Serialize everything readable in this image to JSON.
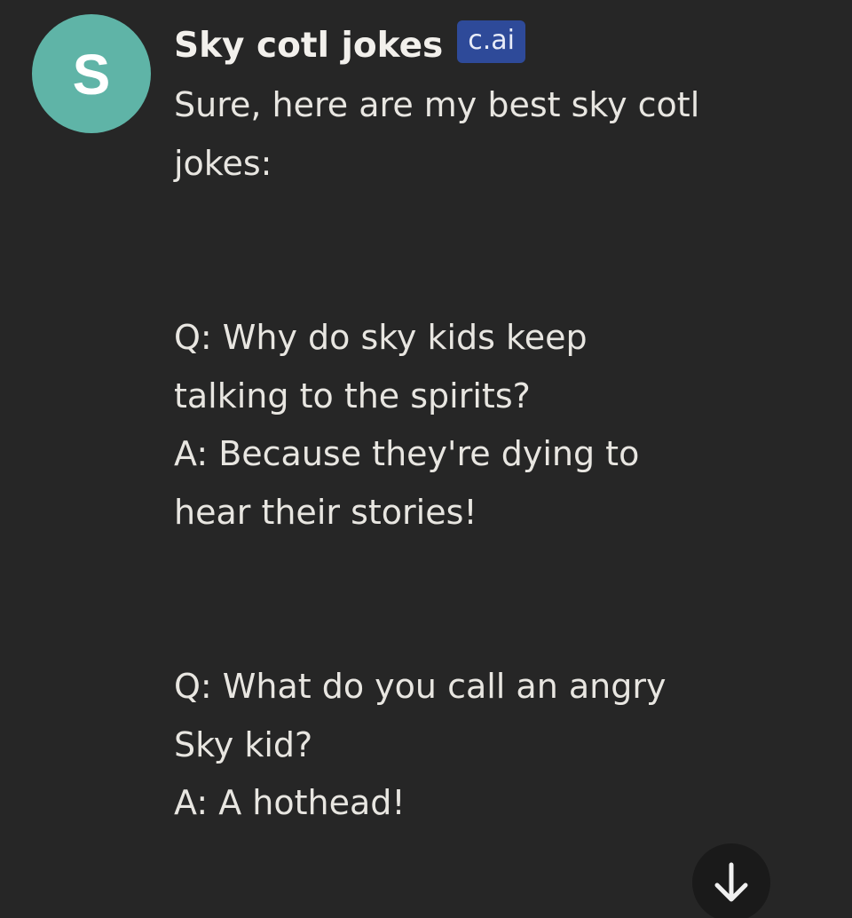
{
  "character": {
    "avatar_letter": "S",
    "name": "Sky cotl jokes",
    "badge": "c.ai"
  },
  "message": {
    "intro_line1": "Sure, here are my best sky cotl",
    "intro_line2": "jokes:",
    "joke1": {
      "q_line1": "Q: Why do sky kids keep",
      "q_line2": "talking to the spirits?",
      "a_line1": "A: Because they're dying to",
      "a_line2": "hear their stories!"
    },
    "joke2": {
      "q_line1": "Q: What do you call an angry",
      "q_line2": "Sky kid?",
      "a_line1": "A: A hothead!"
    }
  },
  "scroll_button": {
    "icon": "arrow-down-icon"
  },
  "colors": {
    "background": "#262626",
    "avatar": "#5fb4a7",
    "badge": "#2e4a99",
    "text": "#e8e6e1"
  }
}
